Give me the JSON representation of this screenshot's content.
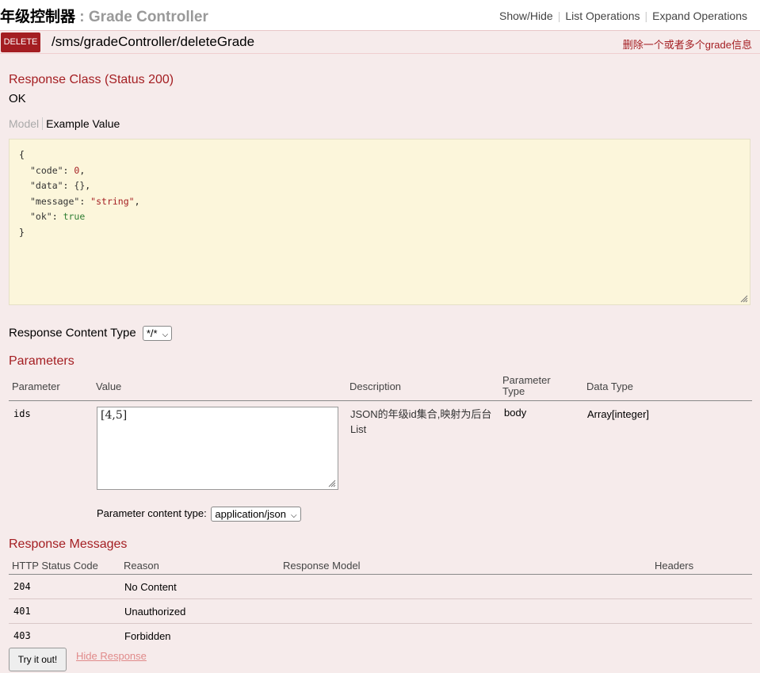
{
  "header": {
    "title_cn": "年级控制器",
    "separator": ":",
    "title_en": "Grade Controller",
    "links": [
      "Show/Hide",
      "List Operations",
      "Expand Operations"
    ]
  },
  "operation": {
    "method": "DELETE",
    "path": "/sms/gradeController/deleteGrade",
    "summary": "删除一个或者多个grade信息"
  },
  "response_class": {
    "heading": "Response Class (Status 200)",
    "status_text": "OK",
    "tab_model": "Model",
    "tab_example": "Example Value",
    "example": {
      "open": "{",
      "code_key": "\"code\"",
      "code_val": "0",
      "data_key": "\"data\"",
      "data_val": "{}",
      "message_key": "\"message\"",
      "message_val": "\"string\"",
      "ok_key": "\"ok\"",
      "ok_val": "true",
      "close": "}"
    }
  },
  "response_content_type": {
    "label": "Response Content Type",
    "value": "*/*"
  },
  "parameters": {
    "heading": "Parameters",
    "columns": [
      "Parameter",
      "Value",
      "Description",
      "Parameter Type",
      "Data Type"
    ],
    "param_name": "ids",
    "param_value": "[4,5]",
    "description": "JSON的年级id集合,映射为后台List",
    "param_type": "body",
    "data_type": "Array[integer]",
    "content_type_label": "Parameter content type:",
    "content_type_value": "application/json"
  },
  "response_messages": {
    "heading": "Response Messages",
    "columns": [
      "HTTP Status Code",
      "Reason",
      "Response Model",
      "Headers"
    ],
    "rows": [
      {
        "code": "204",
        "reason": "No Content"
      },
      {
        "code": "401",
        "reason": "Unauthorized"
      },
      {
        "code": "403",
        "reason": "Forbidden"
      }
    ]
  },
  "actions": {
    "try_label": "Try it out!",
    "hide_label": "Hide Response"
  },
  "colors": {
    "accent": "#a41e22",
    "panel_bg": "#f6ebeb",
    "code_bg": "#fcf6db"
  }
}
